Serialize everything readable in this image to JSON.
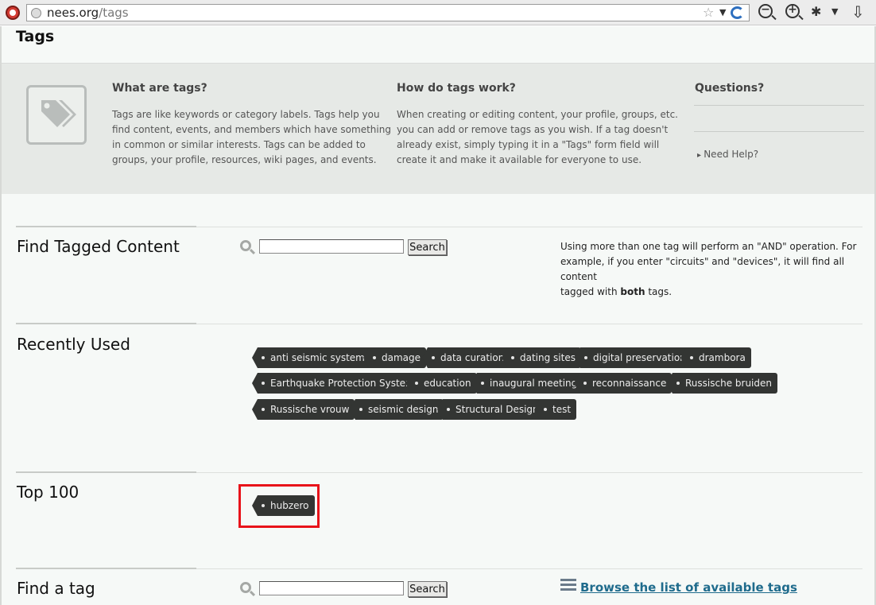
{
  "browser": {
    "url_host": "nees.org",
    "url_path": "/tags"
  },
  "page": {
    "title": "Tags"
  },
  "info": {
    "what_title": "What are tags?",
    "what_lines": [
      "Tags are like keywords or category labels. Tags help you",
      "find content, events, and members which have something",
      "in common or similar interests. Tags can be added to",
      "groups, your profile, resources, wiki pages, and events."
    ],
    "how_title": "How do tags work?",
    "how_lines": [
      "When creating or editing content, your profile, groups, etc.",
      "you can add or remove tags as you wish. If a tag doesn't",
      "already exist, simply typing it in a \"Tags\" form field will",
      "create it and make it available for everyone to use."
    ],
    "questions_title": "Questions?",
    "need_help": "Need Help?"
  },
  "find_tagged": {
    "title": "Find Tagged Content",
    "search_value": "",
    "search_button": "Search",
    "note_line1": "Using more than one tag will perform an \"AND\" operation. For",
    "note_line2": "example, if you enter \"circuits\" and \"devices\", it will find all content",
    "note_line3_pre": "tagged with ",
    "note_line3_bold": "both",
    "note_line3_post": " tags."
  },
  "recently_used": {
    "title": "Recently Used",
    "tags": [
      "anti seismic systems",
      "damage",
      "data curation",
      "dating sites",
      "digital preservation",
      "drambora",
      "Earthquake Protection System",
      "education",
      "inaugural meeting",
      "reconnaissance",
      "Russische bruiden",
      "Russische vrouw",
      "seismic design",
      "Structural Design",
      "test"
    ]
  },
  "top100": {
    "title": "Top 100",
    "tags": [
      "hubzero"
    ]
  },
  "find_tag": {
    "title": "Find a tag",
    "search_value": "",
    "search_button": "Search",
    "browse_link": "Browse the list of available tags"
  }
}
